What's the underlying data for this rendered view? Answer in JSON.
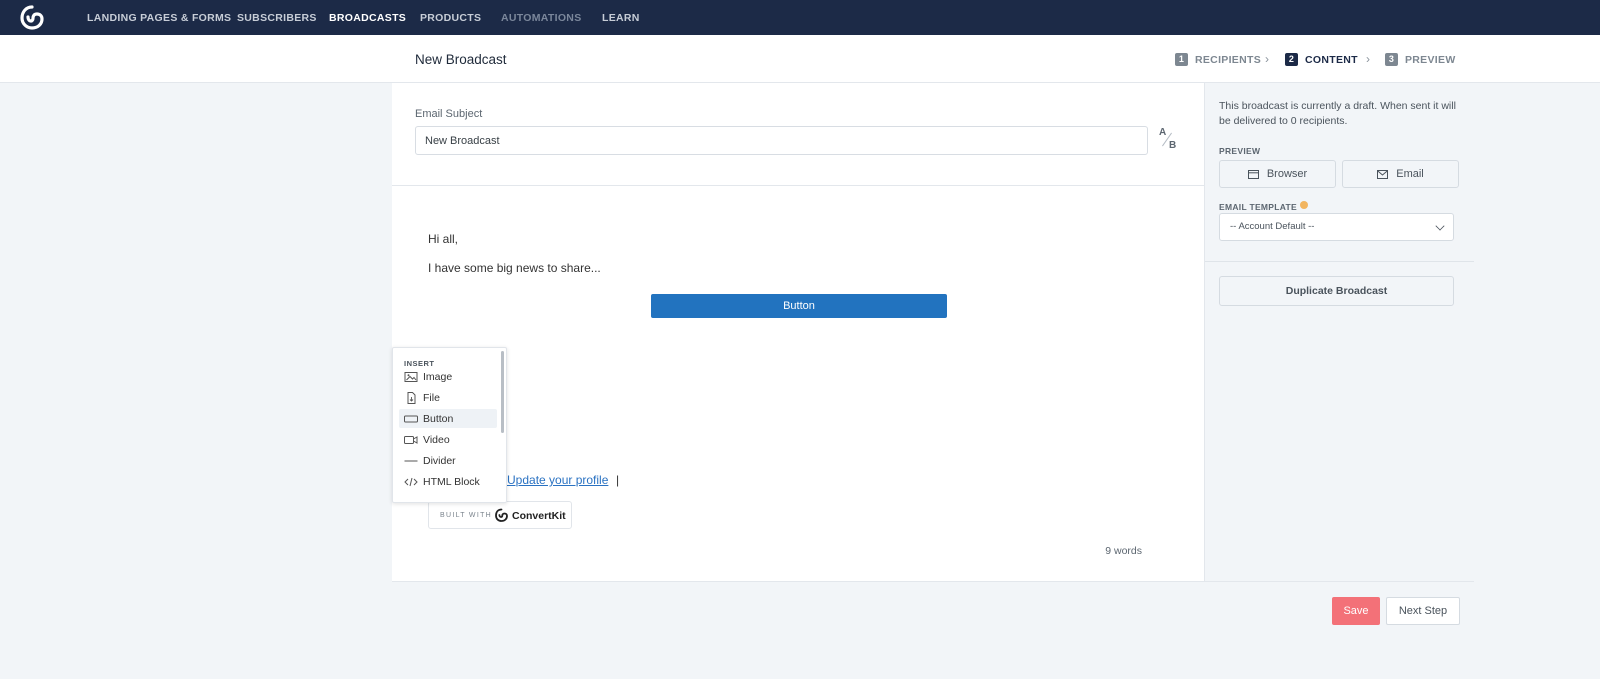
{
  "nav": {
    "logo": "convertkit-logo-icon",
    "items": [
      {
        "label": "LANDING PAGES & FORMS",
        "state": "normal"
      },
      {
        "label": "SUBSCRIBERS",
        "state": "normal"
      },
      {
        "label": "BROADCASTS",
        "state": "active"
      },
      {
        "label": "PRODUCTS",
        "state": "normal"
      },
      {
        "label": "AUTOMATIONS",
        "state": "dim"
      },
      {
        "label": "LEARN",
        "state": "normal"
      }
    ]
  },
  "header": {
    "title": "New Broadcast",
    "steps": [
      {
        "num": "1",
        "label": "RECIPIENTS",
        "active": false
      },
      {
        "num": "2",
        "label": "CONTENT",
        "active": true
      },
      {
        "num": "3",
        "label": "PREVIEW",
        "active": false
      }
    ]
  },
  "editor": {
    "subject_label": "Email Subject",
    "subject_value": "New Broadcast",
    "ab_a": "A",
    "ab_b": "B",
    "greeting": "Hi all,",
    "line1": "I have some big news to share...",
    "button_label": "Button",
    "profile_link": "Update your profile",
    "cursor_text": "|",
    "built_with": "BUILT WITH",
    "brand": "ConvertKit",
    "word_count": "9 words"
  },
  "insert_menu": {
    "title": "INSERT",
    "items": [
      {
        "label": "Image",
        "icon": "image-icon"
      },
      {
        "label": "File",
        "icon": "file-icon"
      },
      {
        "label": "Button",
        "icon": "button-icon",
        "hover": true
      },
      {
        "label": "Video",
        "icon": "video-icon"
      },
      {
        "label": "Divider",
        "icon": "divider-icon"
      },
      {
        "label": "HTML Block",
        "icon": "code-icon"
      }
    ]
  },
  "sidebar": {
    "draft_note": "This broadcast is currently a draft. When sent it will be delivered to 0 recipients.",
    "preview_label": "PREVIEW",
    "browser_label": "Browser",
    "email_label": "Email",
    "template_label": "EMAIL TEMPLATE",
    "template_value": "-- Account Default --",
    "duplicate_label": "Duplicate Broadcast"
  },
  "footer": {
    "save_label": "Save",
    "next_label": "Next Step"
  },
  "colors": {
    "nav_bg": "#1c2a47",
    "primary_button": "#2273bf",
    "save_button": "#f37178",
    "link": "#2a72c2",
    "template_dot": "#f2b560"
  }
}
